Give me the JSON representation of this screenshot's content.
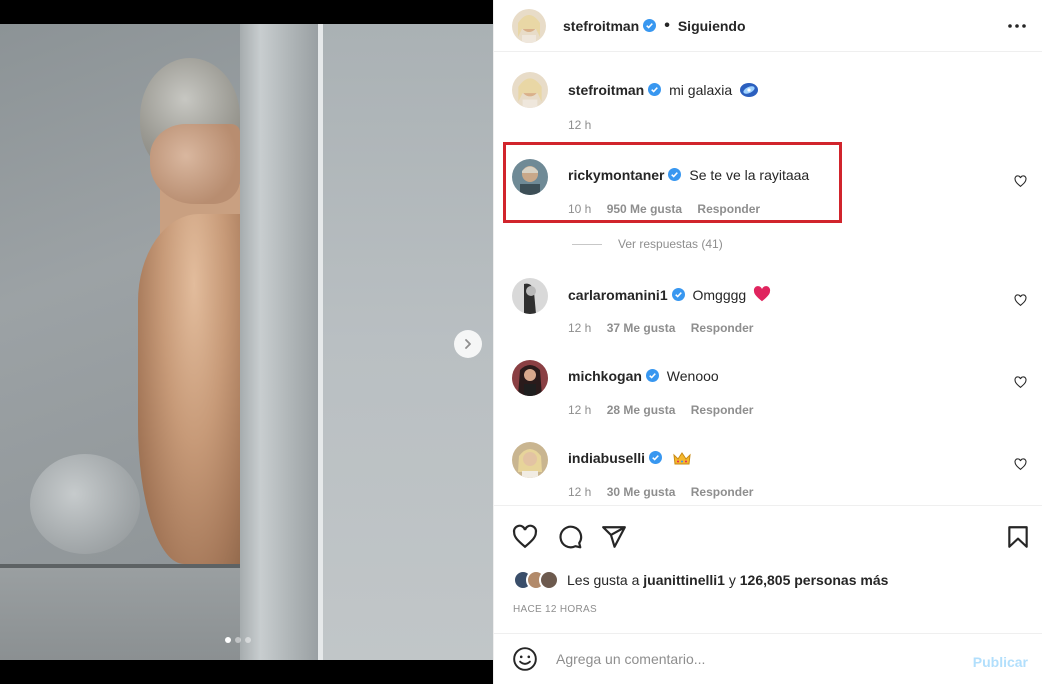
{
  "post": {
    "author": "stefroitman",
    "separator": "•",
    "follow_state": "Siguiendo",
    "caption": "mi galaxia",
    "caption_time": "12 h"
  },
  "comments": [
    {
      "user": "ricky​montaner",
      "text": "Se te ve la rayitaaa",
      "time": "10 h",
      "likes": "950 Me gusta",
      "reply": "Responder",
      "highlighted": true
    },
    {
      "user": "carlaromanini1",
      "text": "Omgggg",
      "time": "12 h",
      "likes": "37 Me gusta",
      "reply": "Responder"
    },
    {
      "user": "michkogan",
      "text": "Wenooo",
      "time": "12 h",
      "likes": "28 Me gusta",
      "reply": "Responder"
    },
    {
      "user": "indiabuselli",
      "text": "",
      "time": "12 h",
      "likes": "30 Me gusta",
      "reply": "Responder"
    }
  ],
  "view_replies": "Ver respuestas (41)",
  "likes": {
    "prefix": "Les gusta a",
    "first_user": "juanittinelli1",
    "connector": "y",
    "rest": "126,805 personas más"
  },
  "time_ago": "HACE 12 HORAS",
  "composer": {
    "placeholder": "Agrega un comentario...",
    "publish_label": "Publicar"
  },
  "carousel": {
    "slides": 3,
    "current": 1
  },
  "colors": {
    "verified": "#3897f0",
    "highlight_border": "#d1242c",
    "publish_disabled": "#b2dffc",
    "heart_emoji": "#e0245e"
  },
  "icons": [
    "verified-badge-icon",
    "more-options-icon",
    "heart-icon",
    "comment-icon",
    "share-icon",
    "bookmark-icon",
    "emoji-icon",
    "chevron-right-icon",
    "galaxy-emoji-icon",
    "red-heart-emoji-icon",
    "crown-emoji-icon"
  ]
}
